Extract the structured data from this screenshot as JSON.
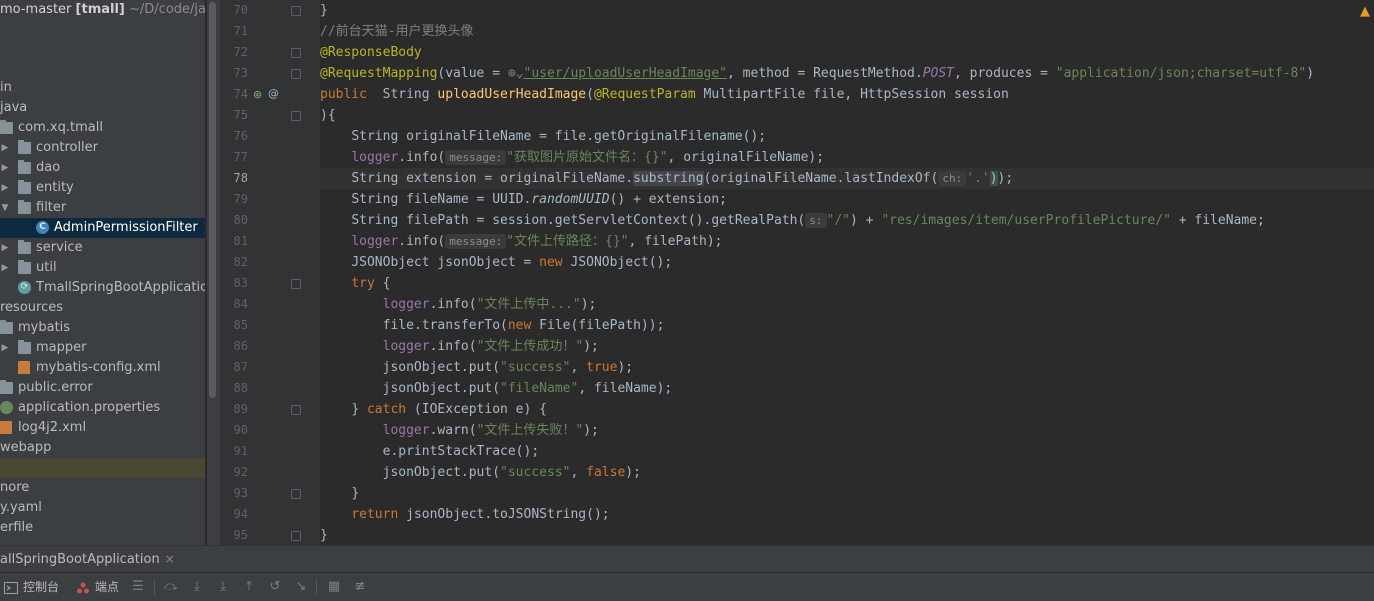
{
  "project_tree": {
    "header": {
      "project": "mo-master",
      "module": "[tmall]",
      "path": "~/D/code/java/"
    },
    "items": [
      {
        "label": "in",
        "icon": "none"
      },
      {
        "label": "java",
        "icon": "source-folder-icon"
      },
      {
        "label": "com.xq.tmall",
        "icon": "package-icon"
      },
      {
        "label": "controller",
        "icon": "package-icon"
      },
      {
        "label": "dao",
        "icon": "package-icon"
      },
      {
        "label": "entity",
        "icon": "package-icon"
      },
      {
        "label": "filter",
        "icon": "package-icon"
      },
      {
        "label": "AdminPermissionFilter",
        "icon": "class-icon"
      },
      {
        "label": "service",
        "icon": "package-icon"
      },
      {
        "label": "util",
        "icon": "package-icon"
      },
      {
        "label": "TmallSpringBootApplication",
        "icon": "spring-boot-icon"
      },
      {
        "label": "resources",
        "icon": "resources-folder-icon"
      },
      {
        "label": "mybatis",
        "icon": "folder-icon"
      },
      {
        "label": "mapper",
        "icon": "folder-icon"
      },
      {
        "label": "mybatis-config.xml",
        "icon": "xml-file-icon"
      },
      {
        "label": "public.error",
        "icon": "folder-icon"
      },
      {
        "label": "application.properties",
        "icon": "properties-icon"
      },
      {
        "label": "log4j2.xml",
        "icon": "xml-file-icon"
      },
      {
        "label": "webapp",
        "icon": "none"
      },
      {
        "label": "",
        "icon": "none"
      },
      {
        "label": "nore",
        "icon": "none"
      },
      {
        "label": "y.yaml",
        "icon": "none"
      },
      {
        "label": "erfile",
        "icon": "none"
      }
    ]
  },
  "editor": {
    "current_line": "78",
    "line_numbers": [
      "70",
      "71",
      "72",
      "73",
      "74",
      "75",
      "76",
      "77",
      "78",
      "79",
      "80",
      "81",
      "82",
      "83",
      "84",
      "85",
      "86",
      "87",
      "88",
      "89",
      "90",
      "91",
      "92",
      "93",
      "94",
      "95"
    ],
    "inlay_hints": {
      "message": "message:",
      "ch": "ch:",
      "s": "s:"
    },
    "t": {
      "c71": "//前台天猫-用户更换头像",
      "a72": "@ResponseBody",
      "a73": "@RequestMapping",
      "m73": "(value = ",
      "u73": "\"user/uploadUserHeadImage\"",
      "r73a": ", method = RequestMethod.",
      "p73": "POST",
      "r73b": ", produces = ",
      "s73": "\"application/json;charset=utf-8\"",
      "e73": ")",
      "k74": "public",
      "r74a": "  String ",
      "f74": "uploadUserHeadImage",
      "r74b": "(",
      "a74": "@RequestParam",
      "r74c": " MultipartFile file, HttpSession session",
      "l75": "){",
      "l76": "String originalFileName = file.getOriginalFilename();",
      "f77": "logger",
      "r77a": ".info(",
      "s77": "\"获取图片原始文件名：{}\"",
      "r77b": ", originalFileName);",
      "r78a": "String extension = originalFileName.",
      "m78": "substring",
      "r78b": "(originalFileName.lastIndexOf(",
      "s78": "'.'",
      "r78c": ")",
      "r78d": ");",
      "r79a": "String fileName = UUID.",
      "i79": "randomUUID",
      "r79b": "() + extension;",
      "r80a": "String filePath = session.getServletContext().getRealPath(",
      "s80a": "\"/\"",
      "r80b": ") + ",
      "s80b": "\"res/images/item/userProfilePicture/\"",
      "r80c": " + fileName;",
      "s81": "\"文件上传路径：{}\"",
      "r81": ", filePath);",
      "r82a": "JSONObject jsonObject = ",
      "k82": "new",
      "r82b": " JSONObject();",
      "k83": "try",
      "r83": " {",
      "s84": "\"文件上传中...\"",
      "r84": ");",
      "r85a": "file.transferTo(",
      "k85": "new",
      "r85b": " File(filePath));",
      "s86": "\"文件上传成功！\"",
      "r86": ");",
      "r87a": "jsonObject.put(",
      "s87": "\"success\"",
      "r87b": ", ",
      "k87": "true",
      "r87c": ");",
      "r88a": "jsonObject.put(",
      "s88": "\"fileName\"",
      "r88b": ", fileName);",
      "r89a": "} ",
      "k89": "catch",
      "r89b": " (IOException e) {",
      "r90": ".warn(",
      "s90": "\"文件上传失败！\"",
      "r90b": ");",
      "l91": "e.printStackTrace();",
      "r92a": "jsonObject.put(",
      "s92": "\"success\"",
      "r92b": ", ",
      "k92": "false",
      "r92c": ");",
      "l93": "}",
      "k94": "return",
      "r94": " jsonObject.toJSONString();",
      "l95": "}",
      "l70": "}"
    }
  },
  "run_panel": {
    "tab_label": "allSpringBootApplication",
    "close_glyph": "×"
  },
  "toolbar": {
    "console_label": "控制台",
    "breakpoints_label": "端点"
  },
  "colors": {
    "keyword": "#cc7832",
    "string": "#6a8759",
    "annotation": "#bbb529",
    "method": "#ffc66d",
    "field": "#9876aa"
  }
}
